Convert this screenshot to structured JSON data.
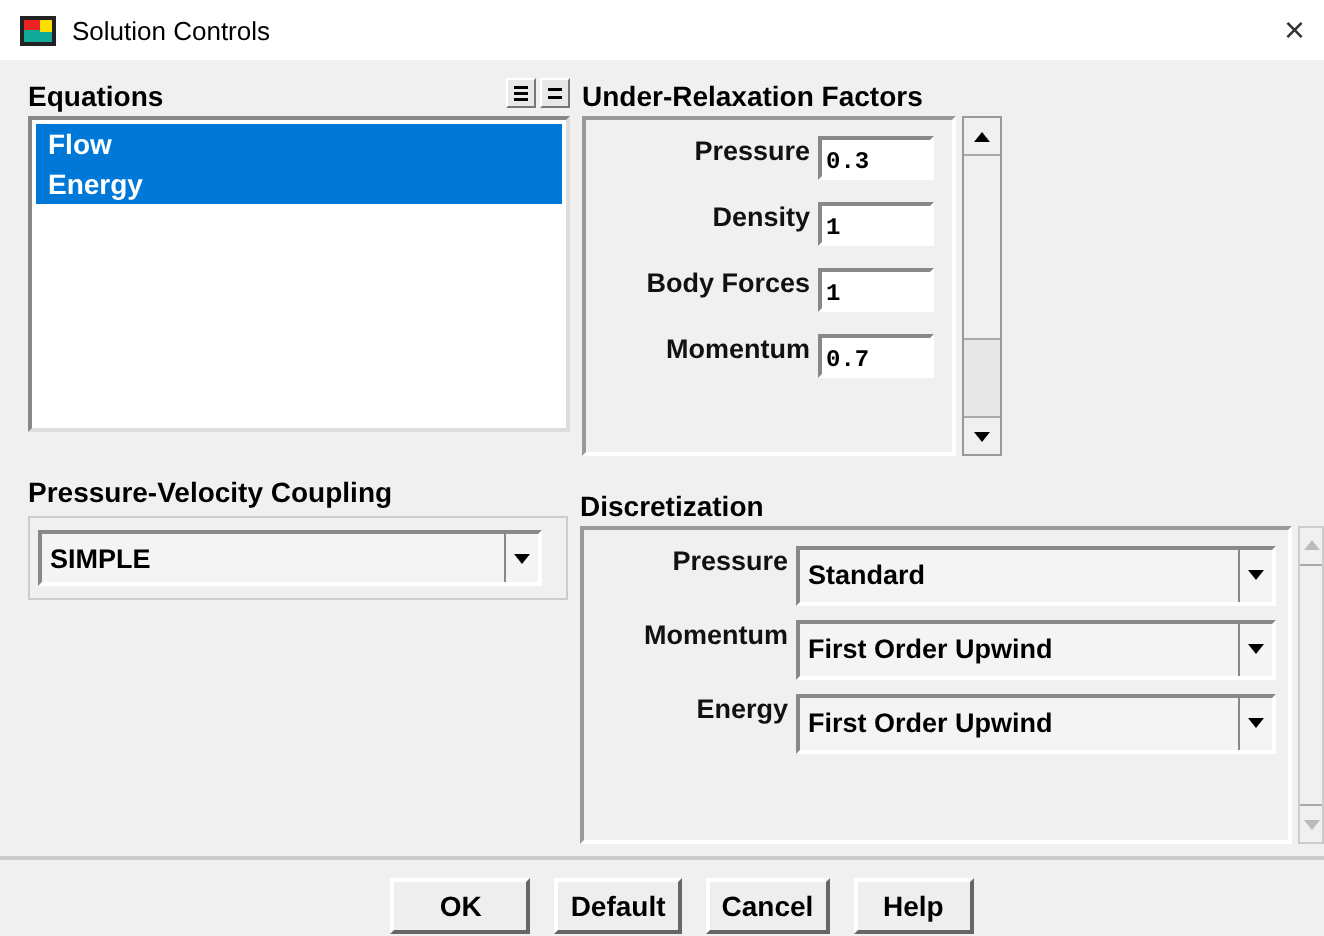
{
  "window": {
    "title": "Solution Controls",
    "close": "×"
  },
  "equations": {
    "label": "Equations",
    "items": [
      {
        "label": "Flow",
        "selected": true
      },
      {
        "label": "Energy",
        "selected": true
      }
    ]
  },
  "coupling": {
    "label": "Pressure-Velocity Coupling",
    "value": "SIMPLE"
  },
  "relaxation": {
    "label": "Under-Relaxation Factors",
    "fields": [
      {
        "label": "Pressure",
        "value": "0.3"
      },
      {
        "label": "Density",
        "value": "1"
      },
      {
        "label": "Body Forces",
        "value": "1"
      },
      {
        "label": "Momentum",
        "value": "0.7"
      }
    ]
  },
  "discretization": {
    "label": "Discretization",
    "fields": [
      {
        "label": "Pressure",
        "value": "Standard"
      },
      {
        "label": "Momentum",
        "value": "First Order Upwind"
      },
      {
        "label": "Energy",
        "value": "First Order Upwind"
      }
    ]
  },
  "buttons": [
    "OK",
    "Default",
    "Cancel",
    "Help"
  ]
}
